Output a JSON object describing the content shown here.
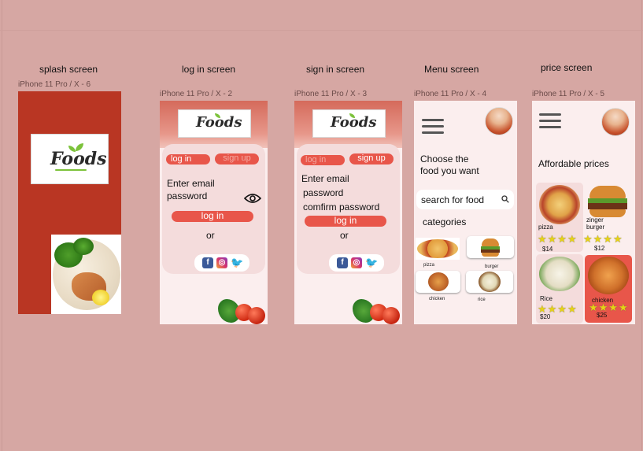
{
  "sections": {
    "splash": {
      "title": "splash screen",
      "frame_label": "iPhone 11 Pro / X - 6"
    },
    "login": {
      "title": "log in screen",
      "frame_label": "iPhone 11 Pro / X - 2"
    },
    "signin": {
      "title": "sign in screen",
      "frame_label": "iPhone 11 Pro / X - 3"
    },
    "menu": {
      "title": "Menu screen",
      "frame_label": "iPhone 11 Pro / X - 4"
    },
    "price": {
      "title": "price  screen",
      "frame_label": "iPhone 11 Pro / X - 5"
    }
  },
  "logo": {
    "text": "Foods"
  },
  "login": {
    "tab_login": "log in",
    "tab_signup": "sign up",
    "email": "Enter email",
    "password": "password",
    "button": "log in",
    "or": "or"
  },
  "signin": {
    "tab_login": "log in",
    "tab_signup": "sign up",
    "email": "Enter email",
    "password": "password",
    "confirm": "comfirm password",
    "button": "log in",
    "or": "or"
  },
  "menu": {
    "headline_1": "Choose the",
    "headline_2": "food you want",
    "search_placeholder": "search for food",
    "categories_title": "categories",
    "items": [
      "pizza",
      "burger",
      "chicken",
      "rice"
    ]
  },
  "price": {
    "title": "Affordable prices",
    "items": [
      {
        "name": "pizza",
        "price": "$14",
        "rating": 4
      },
      {
        "name": "zinger\nburger",
        "price": "$12",
        "rating": 4
      },
      {
        "name": "Rice",
        "price": "$20",
        "rating": 4
      },
      {
        "name": "chicken",
        "price": "$25",
        "rating": 4
      }
    ]
  },
  "social_icons": [
    "facebook-icon",
    "instagram-icon",
    "twitter-icon"
  ],
  "colors": {
    "background": "#d6a7a3",
    "splash_red": "#b93623",
    "accent": "#e8564a",
    "phone_bg": "#fbeeee",
    "card_bg": "#f4dcdc"
  }
}
